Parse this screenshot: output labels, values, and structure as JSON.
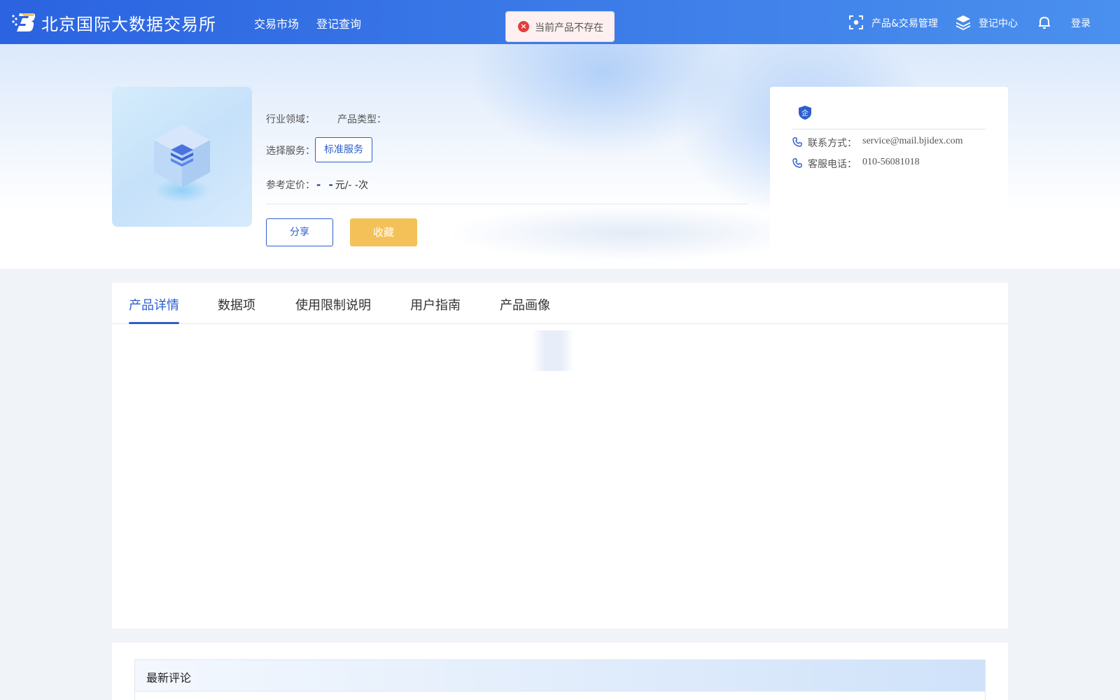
{
  "header": {
    "logo_text": "北京国际大数据交易所",
    "nav": [
      "交易市场",
      "登记查询"
    ],
    "product_mgmt_label": "产品&交易管理",
    "register_center_label": "登记中心",
    "login_label": "登录",
    "icons": [
      "logo-icon",
      "scan-icon",
      "layers-icon",
      "bell-icon"
    ]
  },
  "toast": {
    "message": "当前产品不存在",
    "icon": "error-icon",
    "color": "#e03e3e"
  },
  "product": {
    "industry_label": "行业领域：",
    "type_label": "产品类型：",
    "service_label": "选择服务：",
    "service_option": "标准服务",
    "price_label": "参考定价：",
    "price_dash": "- -",
    "price_unit": "元/- -次",
    "share_label": "分享",
    "favorite_label": "收藏"
  },
  "company": {
    "badge_text": "企",
    "contact_label": "联系方式：",
    "contact_value": "service@mail.bjidex.com",
    "phone_label": "客服电话：",
    "phone_value": "010-56081018"
  },
  "tabs": {
    "items": [
      "产品详情",
      "数据项",
      "使用限制说明",
      "用户指南",
      "产品画像"
    ],
    "active": "产品详情"
  },
  "comments": {
    "title": "最新评论"
  },
  "colors": {
    "primary": "#2d5ecc",
    "header_from": "#2b63e0",
    "header_to": "#4a90ee",
    "favorite": "#f4c158",
    "error": "#e03e3e"
  }
}
